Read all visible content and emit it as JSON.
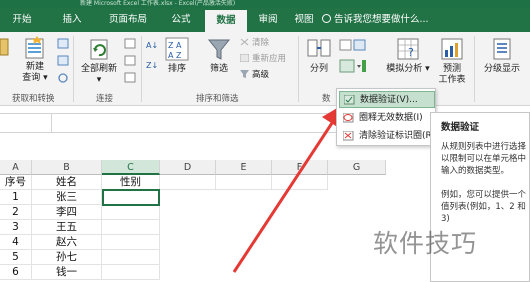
{
  "window_title": "新建 Microsoft Excel 工作表.xlsx - Excel(产品激活失败)",
  "tabs": [
    "开始",
    "插入",
    "页面布局",
    "公式",
    "数据",
    "审阅",
    "视图"
  ],
  "active_tab": "数据",
  "tell_me": "告诉我您想要做什么...",
  "ribbon": {
    "new_query": [
      "新建",
      "查询"
    ],
    "refresh_all": "全部刷新",
    "sort": "排序",
    "filter": "筛选",
    "clear": "清除",
    "reapply": "重新应用",
    "advanced": "高级",
    "text_to_columns": "分列",
    "what_if": "模拟分析",
    "forecast": [
      "预测",
      "工作表"
    ],
    "outline": "分级显示",
    "groups": {
      "get_transform": "获取和转换",
      "connections": "连接",
      "sort_filter": "排序和筛选",
      "data_tools": "数"
    }
  },
  "dropdown": {
    "items": [
      "数据验证(V)...",
      "圈释无效数据(I)",
      "清除验证标识圈(R)"
    ]
  },
  "tooltip": {
    "title": "数据验证",
    "body": "从规则列表中进行选择以限制可以在单元格中输入的数据类型。",
    "body2": "例如，您可以提供一个值列表(例如，1、2 和 3)"
  },
  "sheet": {
    "columns": [
      "A",
      "B",
      "C",
      "D",
      "E",
      "F",
      "G"
    ],
    "headers": [
      "序号",
      "姓名",
      "性别"
    ],
    "rows": [
      [
        "1",
        "张三"
      ],
      [
        "2",
        "李四"
      ],
      [
        "3",
        "王五"
      ],
      [
        "4",
        "赵六"
      ],
      [
        "5",
        "孙七"
      ],
      [
        "6",
        "钱一"
      ]
    ]
  },
  "watermark": "软件技巧",
  "colors": {
    "excel_green": "#217346",
    "arrow_red": "#e53935",
    "highlight": "#c6e0cf"
  }
}
